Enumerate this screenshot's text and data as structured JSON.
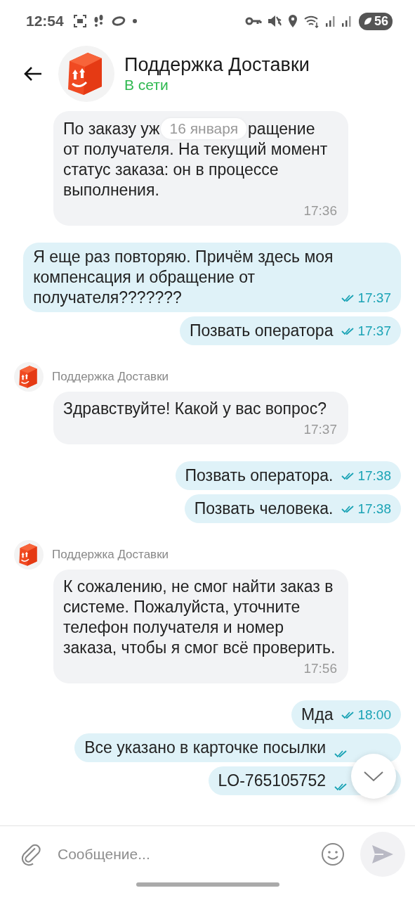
{
  "status_bar": {
    "time": "12:54",
    "battery": "56"
  },
  "header": {
    "title": "Поддержка Доставки",
    "status": "В сети",
    "online": true
  },
  "chat": {
    "date": "16 января",
    "messages": [
      {
        "kind": "incoming",
        "text": [
          "По заказу уж",
          "ращение",
          "от получателя. На текущий момент\nстатус заказа: он в процессе\nвыполнения."
        ],
        "time": "17:36"
      },
      {
        "kind": "outgoing",
        "text": "Я еще раз повторяю. Причём здесь моя\nкомпенсация и обращение от\nполучателя???????",
        "time": "17:37",
        "read": true
      },
      {
        "kind": "outgoing",
        "text": "Позвать оператора",
        "time": "17:37",
        "read": true
      },
      {
        "kind": "sender",
        "name": "Поддержка Доставки"
      },
      {
        "kind": "incoming",
        "text": "Здравствуйте! Какой у вас вопрос?",
        "time": "17:37"
      },
      {
        "kind": "outgoing",
        "text": "Позвать оператора.",
        "time": "17:38",
        "read": true
      },
      {
        "kind": "outgoing",
        "text": "Позвать человека.",
        "time": "17:38",
        "read": true
      },
      {
        "kind": "sender",
        "name": "Поддержка Доставки"
      },
      {
        "kind": "incoming",
        "text": "К сожалению, не смог найти заказ в\nсистеме. Пожалуйста, уточните\nтелефон получателя и номер\nзаказа, чтобы я смог всё проверить.",
        "time": "17:56"
      },
      {
        "kind": "outgoing",
        "text": "Мда",
        "time": "18:00",
        "read": true
      },
      {
        "kind": "outgoing",
        "text": "Все указано в карточке посылки",
        "read": true
      },
      {
        "kind": "outgoing",
        "text": "LO-765105752",
        "read": true
      }
    ]
  },
  "composer": {
    "placeholder": "Сообщение..."
  }
}
